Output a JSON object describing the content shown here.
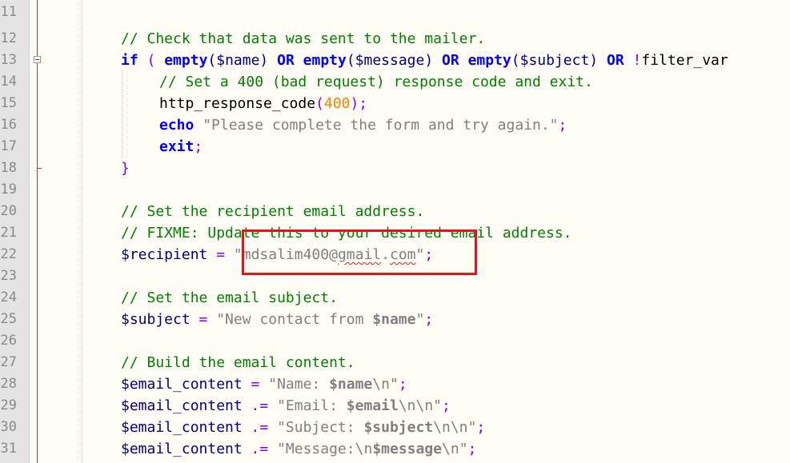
{
  "editor": {
    "line_numbers": [
      "11",
      "12",
      "13",
      "14",
      "15",
      "16",
      "17",
      "18",
      "19",
      "20",
      "21",
      "22",
      "23",
      "24",
      "25",
      "26",
      "27",
      "28",
      "29",
      "30",
      "31"
    ],
    "line12": "// Check that data was sent to the mailer.",
    "line13": {
      "if": "if",
      "paren_open": "(",
      "empty1": "empty",
      "arg1": "($name)",
      "or1": "OR",
      "empty2": "empty",
      "arg2": "($message)",
      "or2": "OR",
      "empty3": "empty",
      "arg3": "($subject)",
      "or3": "OR",
      "not": "!",
      "filter": "filter_var"
    },
    "line14": "// Set a 400 (bad request) response code and exit.",
    "line15": {
      "fn": "http_response_code",
      "open": "(",
      "num": "400",
      "close": ");"
    },
    "line16": {
      "kw": "echo",
      "str": "\"Please complete the form and try again.\"",
      "semi": ";"
    },
    "line17": {
      "kw": "exit",
      "semi": ";"
    },
    "line18": "}",
    "line20": "// Set the recipient email address.",
    "line21": "// FIXME: Update this to your desired email address.",
    "line22": {
      "var": "$recipient",
      "op": " = ",
      "q1": "\"",
      "local": "mdsalim400",
      "at": "@",
      "domain1": "gmail",
      "dot": ".",
      "domain2": "com",
      "q2": "\"",
      "semi": ";"
    },
    "line24": "// Set the email subject.",
    "line25": {
      "var": "$subject",
      "op": " = ",
      "str": "\"New contact from ",
      "bvar": "$name",
      "strend": "\"",
      "semi": ";"
    },
    "line27": "// Build the email content.",
    "line28": {
      "var": "$email_content",
      "op": " = ",
      "str": "\"Name: ",
      "bvar": "$name",
      "esc": "\\n",
      "strend": "\"",
      "semi": ";"
    },
    "line29": {
      "var": "$email_content",
      "op": " .= ",
      "str": "\"Email: ",
      "bvar": "$email",
      "esc": "\\n\\n",
      "strend": "\"",
      "semi": ";"
    },
    "line30": {
      "var": "$email_content",
      "op": " .= ",
      "str": "\"Subject: ",
      "bvar": "$subject",
      "esc": "\\n\\n",
      "strend": "\"",
      "semi": ";"
    },
    "line31": {
      "var": "$email_content",
      "op": " .= ",
      "str": "\"Message:",
      "esc1": "\\n",
      "bvar": "$message",
      "esc2": "\\n",
      "strend": "\"",
      "semi": ";"
    }
  },
  "colors": {
    "comment": "#008000",
    "keyword": "#0000ff",
    "variable": "#000080",
    "string": "#808080",
    "number": "#ff8000",
    "highlight_box": "#e8121a"
  }
}
